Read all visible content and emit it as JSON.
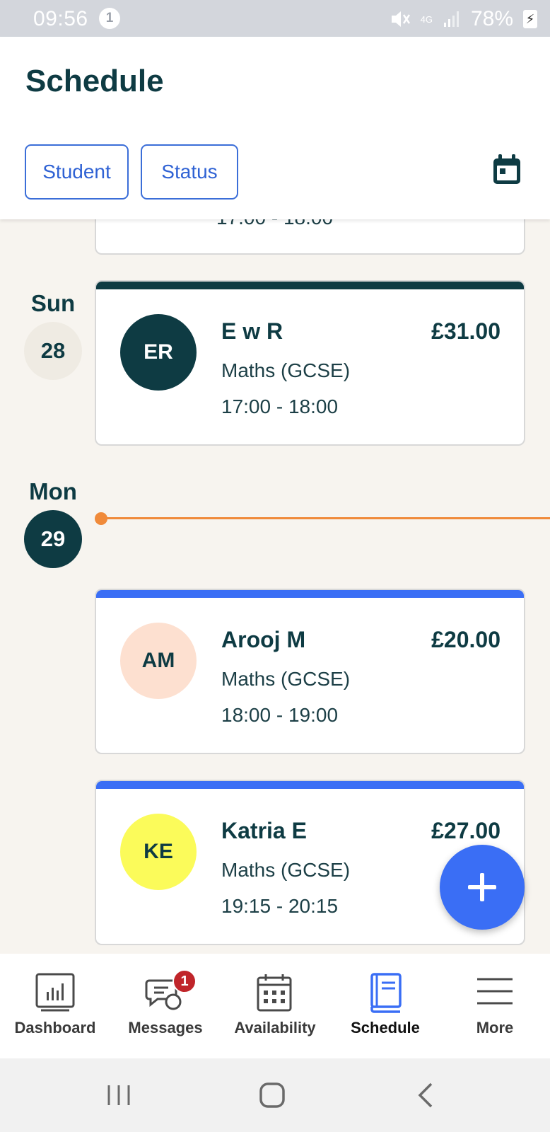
{
  "status_bar": {
    "time": "09:56",
    "notification_count": "1",
    "network": "4G",
    "battery": "78%"
  },
  "header": {
    "title": "Schedule",
    "filters": [
      "Student",
      "Status"
    ]
  },
  "previous_card": {
    "time": "17:00 - 18:00"
  },
  "days": [
    {
      "weekday": "Sun",
      "date": "28"
    },
    {
      "weekday": "Mon",
      "date": "29"
    }
  ],
  "lessons": [
    {
      "initials": "ER",
      "name": "E w R",
      "price": "£31.00",
      "subject": "Maths (GCSE)",
      "time": "17:00 - 18:00",
      "accent": "#0e3b43",
      "avatar_bg": "#0e3b43",
      "avatar_fg": "#ffffff"
    },
    {
      "initials": "AM",
      "name": "Arooj M",
      "price": "£20.00",
      "subject": "Maths (GCSE)",
      "time": "18:00 - 19:00",
      "accent": "#3a6ef5",
      "avatar_bg": "#fde0d0",
      "avatar_fg": "#0e3b43"
    },
    {
      "initials": "KE",
      "name": "Katria E",
      "price": "£27.00",
      "subject": "Maths (GCSE)",
      "time": "19:15 - 20:15",
      "accent": "#3a6ef5",
      "avatar_bg": "#fbfb5a",
      "avatar_fg": "#0e3b43"
    }
  ],
  "bottom_nav": [
    {
      "label": "Dashboard",
      "icon": "dashboard-icon"
    },
    {
      "label": "Messages",
      "icon": "messages-icon",
      "badge": "1"
    },
    {
      "label": "Availability",
      "icon": "calendar-grid-icon"
    },
    {
      "label": "Schedule",
      "icon": "book-icon",
      "active": true
    },
    {
      "label": "More",
      "icon": "menu-icon"
    }
  ],
  "colors": {
    "brand_dark": "#0e3b43",
    "accent_blue": "#3a6ef5",
    "now_line": "#f08a3a",
    "background": "#f7f4ef"
  }
}
